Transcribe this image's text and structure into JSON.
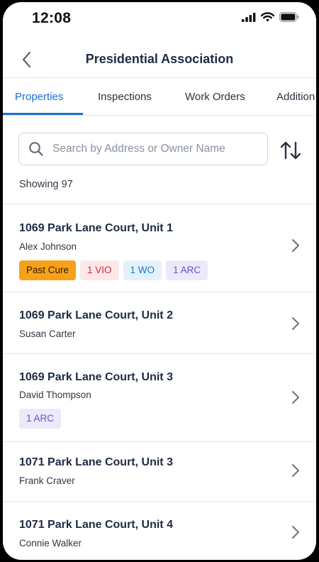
{
  "status_bar": {
    "time": "12:08"
  },
  "header": {
    "title": "Presidential Association"
  },
  "tabs": [
    {
      "label": "Properties",
      "active": true
    },
    {
      "label": "Inspections",
      "active": false
    },
    {
      "label": "Work Orders",
      "active": false
    },
    {
      "label": "Addition",
      "active": false
    }
  ],
  "search": {
    "placeholder": "Search by Address or Owner Name",
    "value": ""
  },
  "showing_text": "Showing 97",
  "properties": [
    {
      "address": "1069 Park Lane Court, Unit 1",
      "owner": "Alex Johnson",
      "badges": [
        {
          "label": "Past Cure",
          "kind": "past-cure"
        },
        {
          "label": "1 VIO",
          "kind": "vio"
        },
        {
          "label": "1 WO",
          "kind": "wo"
        },
        {
          "label": "1 ARC",
          "kind": "arc"
        }
      ]
    },
    {
      "address": "1069 Park Lane Court, Unit 2",
      "owner": "Susan Carter",
      "badges": []
    },
    {
      "address": "1069 Park Lane Court, Unit 3",
      "owner": "David Thompson",
      "badges": [
        {
          "label": "1 ARC",
          "kind": "arc"
        }
      ]
    },
    {
      "address": "1071 Park Lane Court, Unit 3",
      "owner": "Frank Craver",
      "badges": []
    },
    {
      "address": "1071 Park Lane Court, Unit 4",
      "owner": "Connie Walker",
      "badges": []
    }
  ],
  "colors": {
    "accent": "#1a6fd1",
    "past_cure": "#f7a11a",
    "vio": "#d2283a",
    "wo": "#1976d2",
    "arc": "#6752c8"
  },
  "icons": [
    "cellular-signal-icon",
    "wifi-icon",
    "battery-icon",
    "back-chevron-icon",
    "search-icon",
    "sort-icon",
    "chevron-right-icon"
  ]
}
